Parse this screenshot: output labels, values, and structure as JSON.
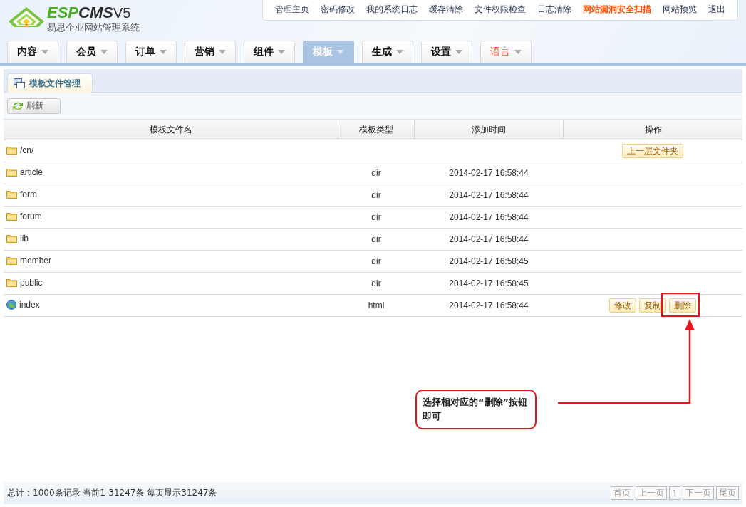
{
  "logo": {
    "mark_a": "ESP",
    "mark_b": "CMS",
    "version": "V5",
    "subtitle": "易思企业网站管理系统"
  },
  "top_links": [
    {
      "label": "管理主页",
      "emphasized": false
    },
    {
      "label": "密码修改",
      "emphasized": false
    },
    {
      "label": "我的系统日志",
      "emphasized": false
    },
    {
      "label": "缓存清除",
      "emphasized": false
    },
    {
      "label": "文件权限检查",
      "emphasized": false
    },
    {
      "label": "日志清除",
      "emphasized": false
    },
    {
      "label": "网站漏洞安全扫描",
      "emphasized": true
    },
    {
      "label": "网站预览",
      "emphasized": false
    },
    {
      "label": "退出",
      "emphasized": false
    }
  ],
  "main_tabs": [
    {
      "label": "内容",
      "selected": false,
      "emphasized": false
    },
    {
      "label": "会员",
      "selected": false,
      "emphasized": false
    },
    {
      "label": "订单",
      "selected": false,
      "emphasized": false
    },
    {
      "label": "营销",
      "selected": false,
      "emphasized": false
    },
    {
      "label": "组件",
      "selected": false,
      "emphasized": false
    },
    {
      "label": "模板",
      "selected": true,
      "emphasized": false
    },
    {
      "label": "生成",
      "selected": false,
      "emphasized": false
    },
    {
      "label": "设置",
      "selected": false,
      "emphasized": false
    },
    {
      "label": "语言",
      "selected": false,
      "emphasized": true
    }
  ],
  "panel_tab": "模板文件管理",
  "toolbar": {
    "refresh": "刷新"
  },
  "table": {
    "columns": [
      "模板文件名",
      "模板类型",
      "添加时间",
      "操作"
    ],
    "rows": [
      {
        "kind": "folder",
        "name": "/cn/",
        "type": "",
        "time": "",
        "actions": [
          "上一层文件夹"
        ]
      },
      {
        "kind": "folder",
        "name": "article",
        "type": "dir",
        "time": "2014-02-17 16:58:44",
        "actions": []
      },
      {
        "kind": "folder",
        "name": "form",
        "type": "dir",
        "time": "2014-02-17 16:58:44",
        "actions": []
      },
      {
        "kind": "folder",
        "name": "forum",
        "type": "dir",
        "time": "2014-02-17 16:58:44",
        "actions": []
      },
      {
        "kind": "folder",
        "name": "lib",
        "type": "dir",
        "time": "2014-02-17 16:58:44",
        "actions": []
      },
      {
        "kind": "folder",
        "name": "member",
        "type": "dir",
        "time": "2014-02-17 16:58:45",
        "actions": []
      },
      {
        "kind": "folder",
        "name": "public",
        "type": "dir",
        "time": "2014-02-17 16:58:45",
        "actions": []
      },
      {
        "kind": "page",
        "name": "index",
        "type": "html",
        "time": "2014-02-17 16:58:44",
        "actions": [
          "修改",
          "复制",
          "删除"
        ]
      }
    ]
  },
  "annotation": {
    "text": "选择相对应的“删除”按钮即可"
  },
  "footer": {
    "summary": "总计：1000条记录 当前1-31247条 每页显示31247条",
    "pager": [
      "首页",
      "上一页",
      "1",
      "下一页",
      "尾页"
    ]
  }
}
